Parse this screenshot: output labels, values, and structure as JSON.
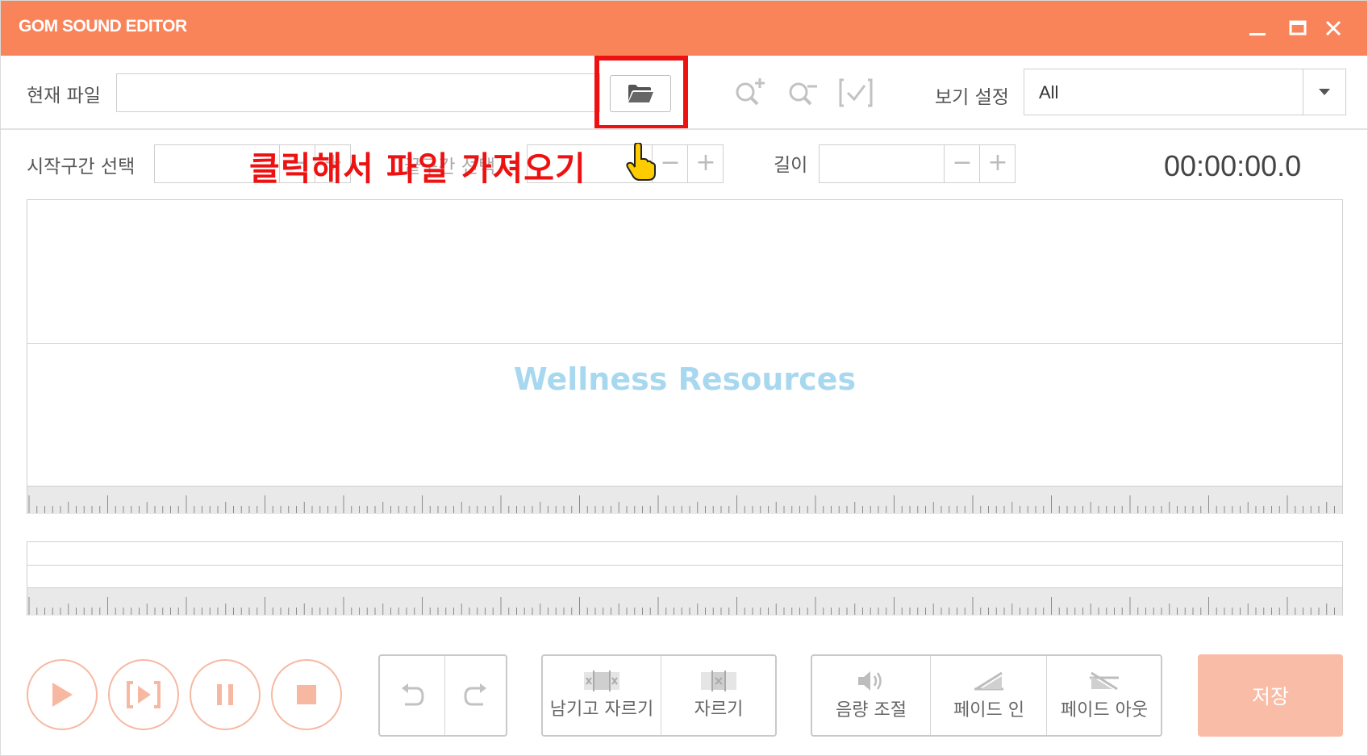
{
  "app": {
    "title": "GOM SOUND EDITOR"
  },
  "window_controls": {
    "minimize": "minimize-icon",
    "maximize": "maximize-icon",
    "close": "close-icon"
  },
  "file": {
    "label": "현재 파일",
    "value": "",
    "browse_icon": "folder-open-icon"
  },
  "toolbar": {
    "zoom_in_icon": "zoom-in-icon",
    "zoom_out_icon": "zoom-out-icon",
    "fit_icon": "check-fit-icon"
  },
  "view": {
    "label": "보기 설정",
    "selected": "All"
  },
  "range": {
    "start_label": "시작구간 선택",
    "end_label": "끝구간 선택",
    "length_label": "길이",
    "minus": "−",
    "plus": "+"
  },
  "current_time": "00:00:00.0",
  "annotation": {
    "text": "클릭해서 파일 가져오기",
    "color": "#ee1111"
  },
  "watermark": "Wellness Resources",
  "playback": {
    "play_icon": "play-icon",
    "play_selection_icon": "play-selection-icon",
    "pause_icon": "pause-icon",
    "stop_icon": "stop-icon"
  },
  "history": {
    "undo_icon": "undo-icon",
    "redo_icon": "redo-icon"
  },
  "edit": {
    "keep_cut": "남기고 자르기",
    "cut": "자르기"
  },
  "effects": {
    "volume": "음량 조절",
    "fade_in": "페이드 인",
    "fade_out": "페이드 아웃"
  },
  "save": "저장",
  "colors": {
    "accent": "#f9845a",
    "accent_light": "#f7b8a2",
    "save_bg": "#f9bca6",
    "highlight": "#ee1111",
    "watermark": "#a8d8ef"
  }
}
